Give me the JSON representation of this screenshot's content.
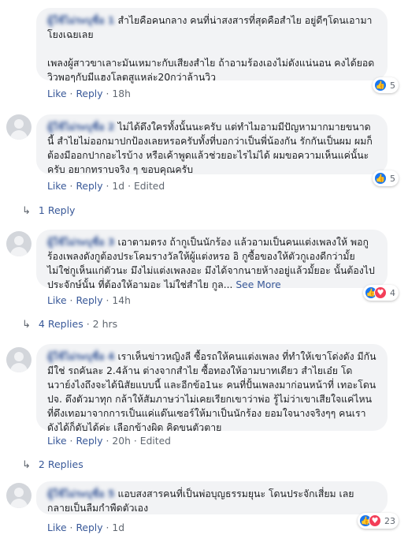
{
  "comments": [
    {
      "author": "ผู้ใช้ไม่ระบุชื่อ 1",
      "paragraphs": [
        "สำไยคือคนกลาง คนที่น่าสงสารที่สุดคือสำไย อยู่ดีๆโดนเอามาโยงเฉยเลย",
        "เพลงผู้สาวขาเลาะมันเหมาะกับเสียงสำไย ถ้าอามร้องเองไม่ดังแน่นอน คงได้ยอดวิวพอๆกับมีแฮงโลตสูแหล่ะ20กว่าล้านวิว"
      ],
      "reaction_count": "5",
      "actions": {
        "like": "Like",
        "reply": "Reply",
        "time": "18h"
      }
    },
    {
      "author": "ผู้ใช้ไม่ระบุชื่อ 2",
      "paragraphs": [
        "ไม่ได้ดึงใครทั้งนั้นนะครับ แต่ทำไมอามมีปัญหามากมายขนาดนี้ สำไยไม่ออกมาปกป้องเลยหรอครับทั้งที่บอกว่าเป็นพี่น้องกัน รักกันเป็นผม ผมก็ต้องมีออกปากอะไรบ้าง หรือเค้าพูดแล้วช่วยอะไรไม่ได้ ผมขอความเห็นแค่นั้นะครับ อยากทราบจริง ๆ ขอบคุณครับ"
      ],
      "reaction_count": "5",
      "actions": {
        "like": "Like",
        "reply": "Reply",
        "time": "1d",
        "edited": "Edited"
      },
      "replies": {
        "label": "1 Reply"
      }
    },
    {
      "author": "ผู้ใช้ไม่ระบุชื่อ 3",
      "paragraphs": [
        "เอาตามตรง ถ้ากูเป็นนักร้อง แล้วอามเป็นคนแต่งเพลงให้ พอกูร้องเพลงดังกูต้องประโคมรางวัลให้ผู้แต่งหรอ อิ กูซื้อของให้ตัวกูเองดีกว่ามั้ย ไม่ใช่กูเห็นแก่ตัวนะ มึงไม่แต่งเพลงอะ มึงได้จากนายห้างอยู่แล้วมั้ยอะ นั้นต้องไปประจักษ์นั้น ที่ต้องให้อามอะ ไม่ใช่สำไย กูล..."
      ],
      "see_more": "See More",
      "reaction_count": "4",
      "actions": {
        "like": "Like",
        "reply": "Reply",
        "time": "14h"
      },
      "replies": {
        "label": "4 Replies",
        "time": "2 hrs"
      }
    },
    {
      "author": "ผู้ใช้ไม่ระบุชื่อ 4",
      "paragraphs": [
        "เราเห็นข่าวหญิงลี ซื้อรถให้คนแต่งเพลง ที่ทำให้เขาโด่งดัง มีกันมีใช่ รถคันละ 2.4ล้าน ต่างจากสำไย ซื้อทองให้อามบาทเดียว สำไยเอ๋ย โดนวาย์งไงถึงจะได้นิสัยแบบนี้ และอีกข้อ1นะ คนที่ปั้นเพลงมาก่อนหน้าที่ เทอะโดน ปจ. ดึงตัวมาทุก กล้าให้สัมภาษว่าไม่เคยเรียกเขาว่าพ่อ รู้ไม่ว่าเขาเสียใจแค่ไหน ที่ดึงเทอมาจากการเป็นแค่แด๊นเซอร์ให้มาเป็นนักร้อง ยอมใจนางจริงๆๆ คนเราดังได้ก็ดับได้ค่ะ เลือกข้างผิด คิดขนตัวตาย"
      ],
      "actions": {
        "like": "Like",
        "reply": "Reply",
        "time": "20h",
        "edited": "Edited"
      },
      "replies": {
        "label": "2 Replies"
      }
    },
    {
      "author": "ผู้ใช้ไม่ระบุชื่อ 5",
      "paragraphs": [
        "แอบสงสารคนที่เป็นพ่อบุญธรรมยุนะ โดนประจักเสี่ยม เลยกลายเป็นลืมกำพืดตัวเอง"
      ],
      "reaction_count": "23",
      "actions": {
        "like": "Like",
        "reply": "Reply",
        "time": "1d"
      }
    }
  ],
  "colors": {
    "link": "#385898",
    "meta": "#606770",
    "bubble": "#f2f3f5",
    "like": "#1877f2",
    "love": "#f33e58"
  },
  "icons": {
    "reply_arrow": "reply-arrow-icon",
    "like": "thumbs-up-icon",
    "love": "heart-icon"
  }
}
